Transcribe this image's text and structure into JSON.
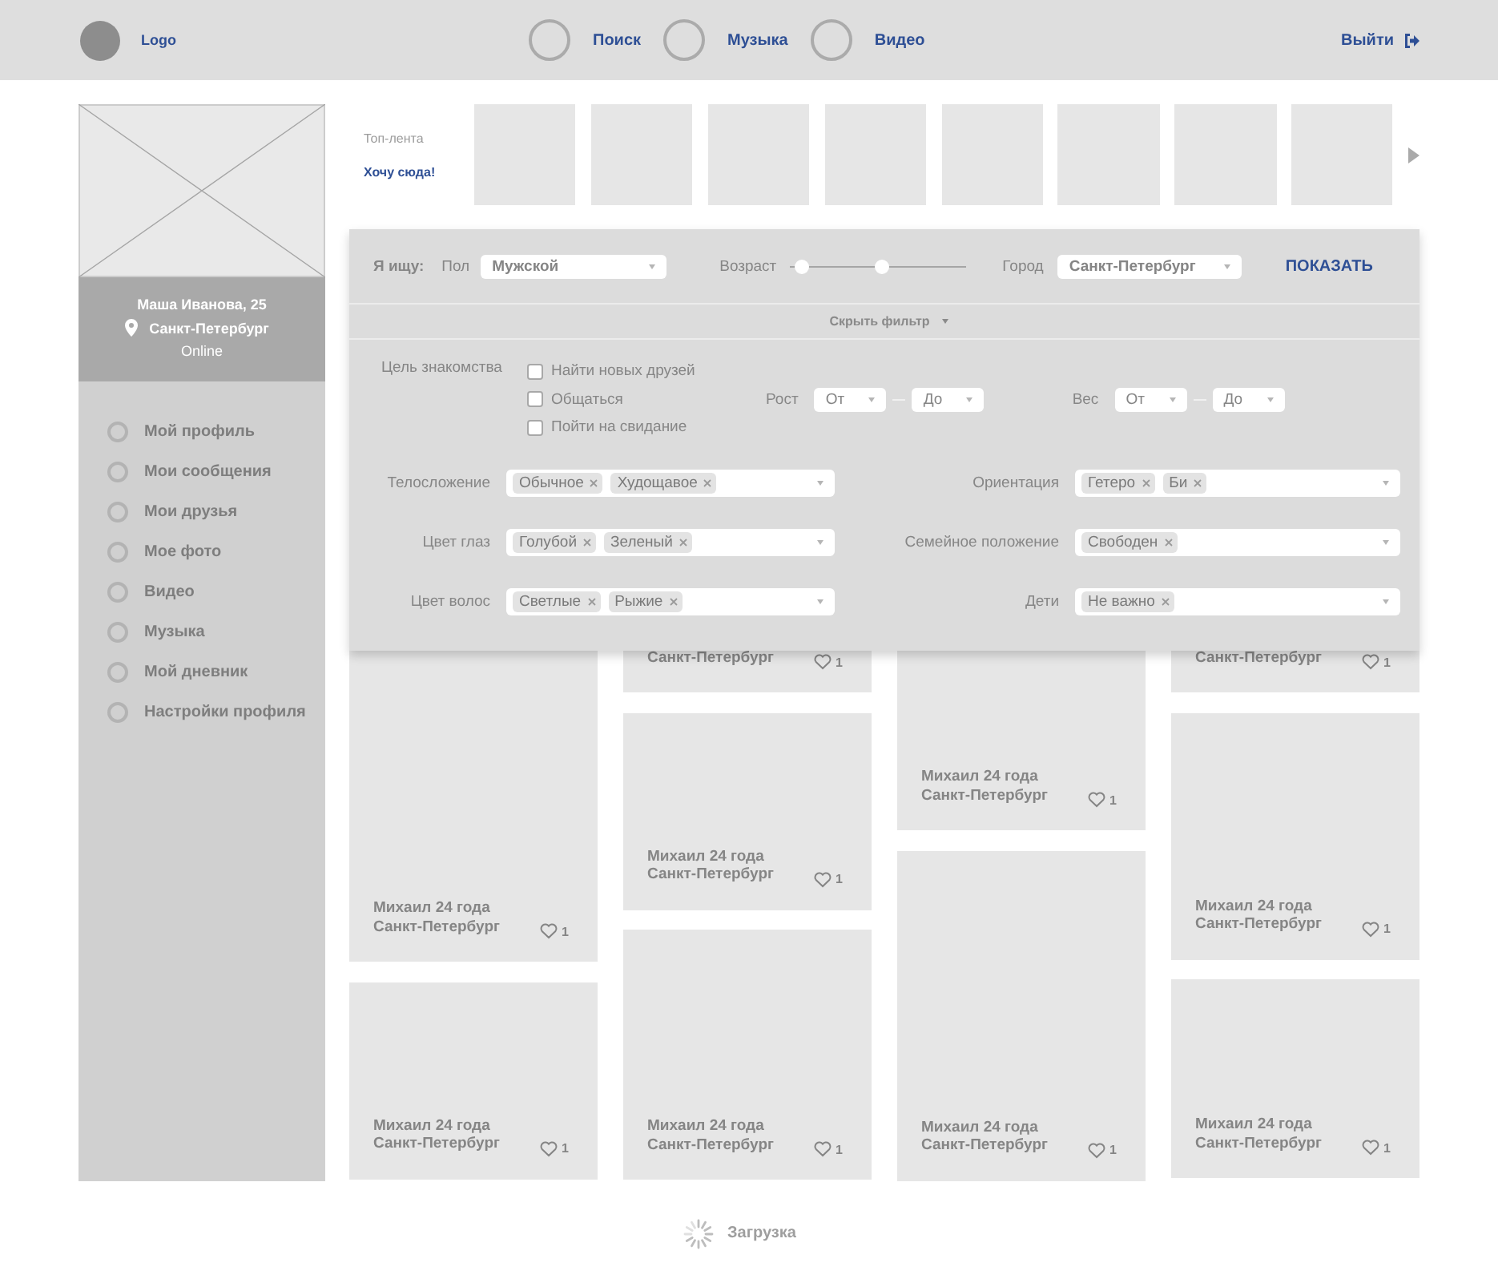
{
  "header": {
    "logo": "Logo",
    "nav": [
      {
        "label": "Поиск"
      },
      {
        "label": "Музыка"
      },
      {
        "label": "Видео"
      }
    ],
    "logout": "Выйти"
  },
  "sidebar": {
    "profile": {
      "name": "Маша Иванова, 25",
      "city": "Санкт-Петербург",
      "status": "Online"
    },
    "menu": [
      {
        "label": "Мой профиль"
      },
      {
        "label": "Мои сообщения"
      },
      {
        "label": "Мои друзья"
      },
      {
        "label": "Мое фото"
      },
      {
        "label": "Видео"
      },
      {
        "label": "Музыка"
      },
      {
        "label": "Мой дневник"
      },
      {
        "label": "Настройки профиля"
      }
    ]
  },
  "top_feed": {
    "title": "Топ-лента",
    "link": "Хочу сюда!",
    "thumbnails": [
      {
        "kind": "placeholder"
      },
      {
        "kind": "placeholder"
      },
      {
        "kind": "placeholder"
      },
      {
        "kind": "placeholder"
      },
      {
        "kind": "placeholder"
      },
      {
        "kind": "placeholder"
      },
      {
        "kind": "placeholder"
      },
      {
        "kind": "placeholder"
      }
    ]
  },
  "filter": {
    "looking_for": "Я ищу:",
    "gender": {
      "label": "Пол",
      "value": "Мужской"
    },
    "age": {
      "label": "Возраст",
      "thumbs": [
        {
          "level": 0.07
        },
        {
          "level": 0.53
        }
      ]
    },
    "city": {
      "label": "Город",
      "value": "Санкт-Петербург"
    },
    "show_button": "ПОКАЗАТЬ",
    "toggle": {
      "label": "Скрыть фильтр",
      "expanded": true
    },
    "goal": {
      "label": "Цель знакомства",
      "options": [
        {
          "label": "Найти новых друзей",
          "checked": false
        },
        {
          "label": "Общаться",
          "checked": false
        },
        {
          "label": "Пойти на свидание",
          "checked": false
        }
      ]
    },
    "height": {
      "label": "Рост",
      "from": "От",
      "to": "До"
    },
    "weight": {
      "label": "Вес",
      "from": "От",
      "to": "До"
    },
    "multiselects": [
      {
        "label": "Телосложение",
        "tags": [
          "Обычное",
          "Худощавое"
        ]
      },
      {
        "label": "Ориентация",
        "tags": [
          "Гетеро",
          "Би"
        ]
      },
      {
        "label": "Цвет глаз",
        "tags": [
          "Голубой",
          "Зеленый"
        ]
      },
      {
        "label": "Семейное положение",
        "tags": [
          "Свободен"
        ]
      },
      {
        "label": "Цвет волос",
        "tags": [
          "Светлые",
          "Рыжие"
        ]
      },
      {
        "label": "Дети",
        "tags": [
          "Не важно"
        ]
      }
    ]
  },
  "cards": {
    "columns": [
      [
        {
          "name": "Михаил 24 года",
          "city": "Санкт-Петербург",
          "likes": "1"
        },
        {
          "name": "Михаил 24 года",
          "city": "Санкт-Петербург",
          "likes": "1"
        }
      ],
      [
        {
          "city": "Санкт-Петербург",
          "likes": "1"
        },
        {
          "name": "Михаил 24 года",
          "city": "Санкт-Петербург",
          "likes": "1"
        },
        {
          "name": "Михаил 24 года",
          "city": "Санкт-Петербург",
          "likes": "1"
        }
      ],
      [
        {
          "name": "Михаил 24 года",
          "city": "Санкт-Петербург",
          "likes": "1"
        },
        {
          "name": "Михаил 24 года",
          "city": "Санкт-Петербург",
          "likes": "1"
        }
      ],
      [
        {
          "city": "Санкт-Петербург",
          "likes": "1"
        },
        {
          "name": "Михаил 24 года",
          "city": "Санкт-Петербург",
          "likes": "1"
        },
        {
          "name": "Михаил 24 года",
          "city": "Санкт-Петербург",
          "likes": "1"
        }
      ]
    ]
  },
  "loading": "Загрузка"
}
